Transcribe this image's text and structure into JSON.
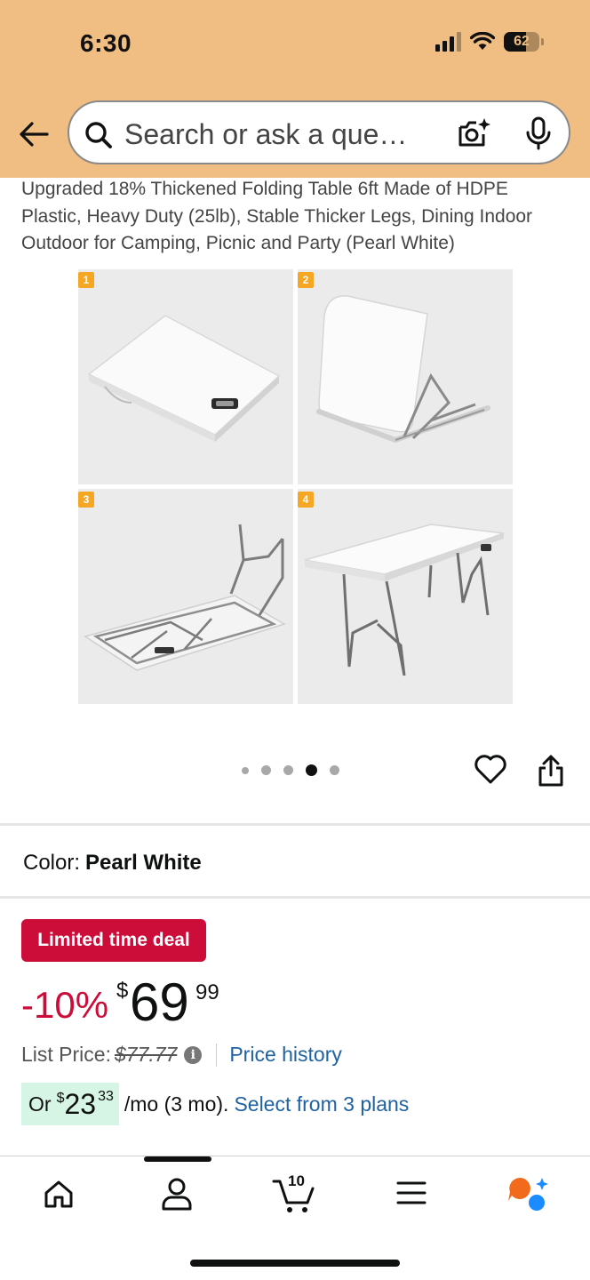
{
  "status_bar": {
    "time": "6:30",
    "battery_level": "62"
  },
  "search": {
    "placeholder": "Search or ask a que…"
  },
  "product": {
    "title": "Upgraded 18% Thickened Folding Table 6ft Made of HDPE Plastic, Heavy Duty (25lb), Stable Thicker Legs, Dining Indoor Outdoor for Camping, Picnic and Party (Pearl White)",
    "images": [
      {
        "badge": "1",
        "icon": "folded-table-image"
      },
      {
        "badge": "2",
        "icon": "half-open-table-image"
      },
      {
        "badge": "3",
        "icon": "table-underside-image"
      },
      {
        "badge": "4",
        "icon": "open-table-image"
      }
    ],
    "carousel": {
      "total": 5,
      "active_index": 3
    }
  },
  "color": {
    "label": "Color:",
    "value": "Pearl White"
  },
  "deal": {
    "badge": "Limited time deal",
    "discount": "-10%",
    "currency": "$",
    "price_whole": "69",
    "price_fraction": "99",
    "list_price_label": "List Price:",
    "list_price": "$77.77",
    "price_history": "Price history"
  },
  "installments": {
    "prefix": "Or",
    "currency": "$",
    "amount_whole": "23",
    "amount_fraction": "33",
    "term": "/mo (3 mo).",
    "plans_link": "Select from 3 plans"
  },
  "bottom_nav": {
    "cart_count": "10",
    "items": [
      "home-icon",
      "account-icon",
      "cart-icon",
      "menu-icon",
      "rufus-icon"
    ]
  },
  "colors": {
    "header_bg": "#f0bd82",
    "deal_red": "#cc0c39",
    "link_blue": "#2162a1",
    "installment_bg": "#d6f5e5",
    "badge_orange": "#f5a623"
  }
}
